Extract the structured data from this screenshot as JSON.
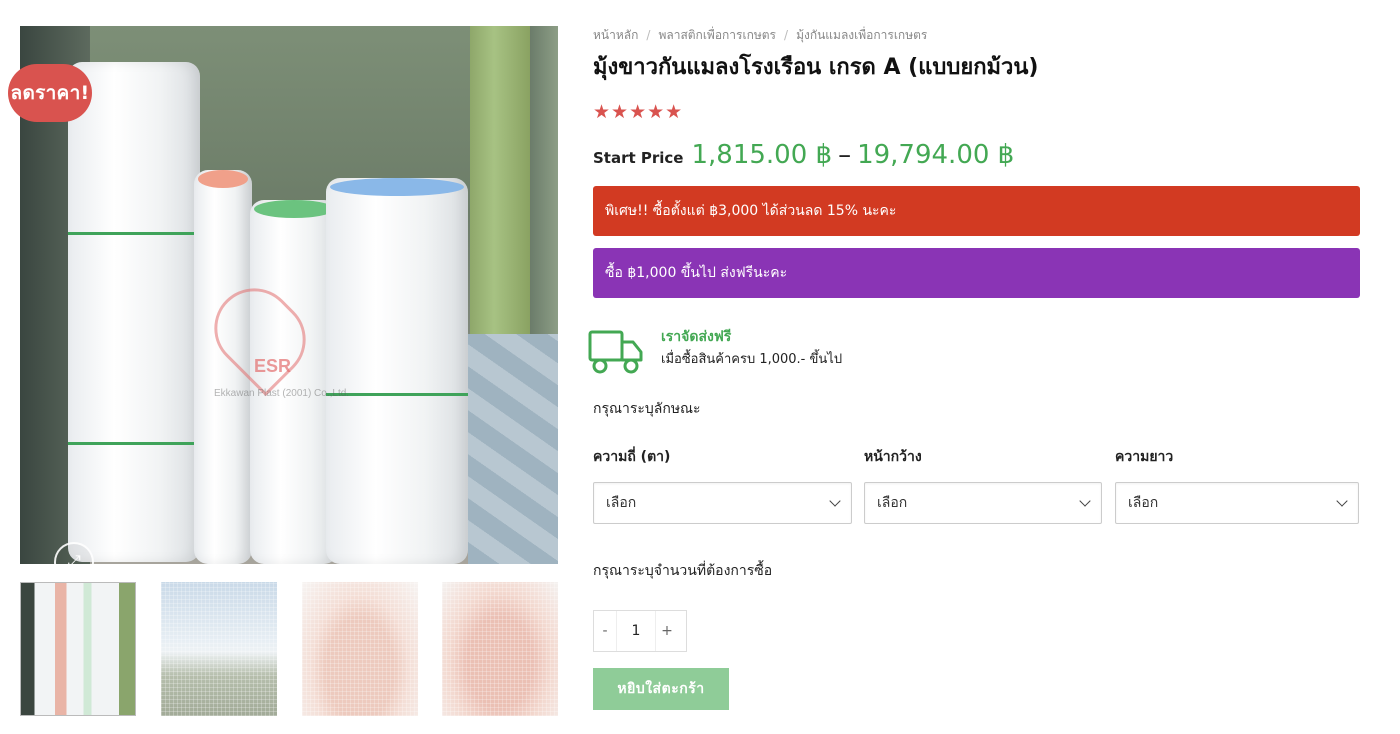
{
  "gallery": {
    "badge": "ลดราคา!",
    "watermark_brand": "ESR",
    "watermark_company": "Ekkawan Plast (2001) Co.,Ltd.",
    "zoom_icon": "expand-icon"
  },
  "breadcrumb": [
    "หน้าหลัก",
    "พลาสติกเพื่อการเกษตร",
    "มุ้งกันแมลงเพื่อการเกษตร"
  ],
  "breadcrumb_sep": "/",
  "product": {
    "title": "มุ้งขาวกันแมลงโรงเรือน เกรด A (แบบยกม้วน)",
    "rating_stars": "★★★★★",
    "rating_value": 5,
    "price_prefix": "Start Price",
    "price_min": "1,815.00 ฿",
    "price_dash": "–",
    "price_max": "19,794.00 ฿"
  },
  "promos": {
    "discount": "พิเศษ!! ซื้อตั้งแต่ ฿3,000 ได้ส่วนลด 15% นะคะ",
    "shipping": "ซื้อ ฿1,000 ขึ้นไป ส่งฟรีนะคะ"
  },
  "free_shipping": {
    "title": "เราจัดส่งฟรี",
    "subtitle": "เมื่อซื้อสินค้าครบ 1,000.- ขึ้นไป",
    "icon": "truck-icon"
  },
  "attributes": {
    "heading": "กรุณาระบุลักษณะ",
    "fields": [
      {
        "label": "ความถี่ (ตา)",
        "value": "เลือก"
      },
      {
        "label": "หน้ากว้าง",
        "value": "เลือก"
      },
      {
        "label": "ความยาว",
        "value": "เลือก"
      }
    ]
  },
  "quantity": {
    "heading": "กรุณาระบุจำนวนที่ต้องการซื้อ",
    "minus": "-",
    "value": "1",
    "plus": "+"
  },
  "cart": {
    "add_label": "หยิบใส่ตะกร้า"
  },
  "colors": {
    "sale_badge": "#d9534f",
    "price": "#43a853",
    "promo_red": "#d23a22",
    "promo_purple": "#8a34b5",
    "add_to_cart": "#8fcc98"
  }
}
